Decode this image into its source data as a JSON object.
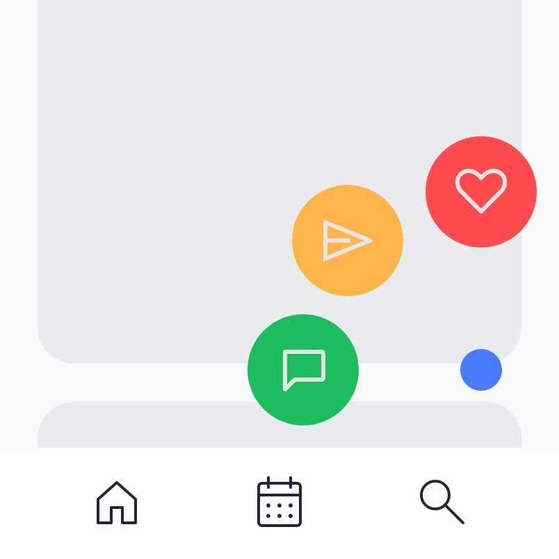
{
  "colors": {
    "background": "#f8f9fb",
    "card": "#e9ebee",
    "like": "#ff4b4e",
    "send": "#ffb54a",
    "comment": "#1bbd5e",
    "toggle": "#4a7dfc",
    "icon_on_fab": "#e6e6e6",
    "nav_bar": "#ffffff",
    "nav_icon": "#232636"
  },
  "feed": {
    "cards": [
      "card-1",
      "card-2"
    ]
  },
  "fab_menu": {
    "actions": [
      {
        "name": "like",
        "icon": "heart-icon"
      },
      {
        "name": "send",
        "icon": "send-icon"
      },
      {
        "name": "comment",
        "icon": "comment-icon"
      }
    ],
    "toggle_icon": "dot"
  },
  "bottom_nav": {
    "items": [
      {
        "name": "home",
        "icon": "home-icon"
      },
      {
        "name": "calendar",
        "icon": "calendar-icon"
      },
      {
        "name": "search",
        "icon": "search-icon"
      }
    ]
  }
}
